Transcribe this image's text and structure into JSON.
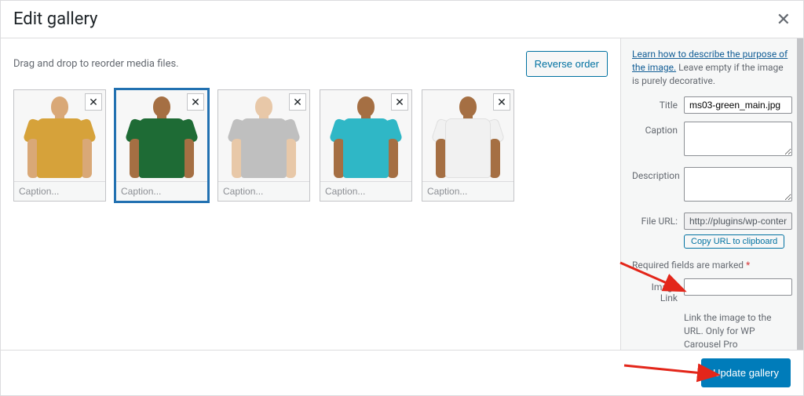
{
  "header": {
    "title": "Edit gallery"
  },
  "gallery": {
    "instructions": "Drag and drop to reorder media files.",
    "reverse_label": "Reverse order",
    "caption_placeholder": "Caption...",
    "items": [
      {
        "shirt_color": "c-yellow",
        "skin": "skin",
        "selected": false
      },
      {
        "shirt_color": "c-green",
        "skin": "skin2",
        "selected": true
      },
      {
        "shirt_color": "c-grey",
        "skin": "skin3",
        "selected": false
      },
      {
        "shirt_color": "c-teal",
        "skin": "skin2",
        "selected": false
      },
      {
        "shirt_color": "c-white",
        "skin": "skin2",
        "selected": false
      }
    ]
  },
  "sidebar": {
    "help_link": "Learn how to describe the purpose of the image.",
    "help_tail": " Leave empty if the image is purely decorative.",
    "title_label": "Title",
    "title_value": "ms03-green_main.jpg",
    "caption_label": "Caption",
    "description_label": "Description",
    "fileurl_label": "File URL:",
    "fileurl_value": "http://plugins/wp-conten",
    "copy_label": "Copy URL to clipboard",
    "required_text": "Required fields are marked ",
    "required_mark": "*",
    "imagelink_label": "Image Link",
    "imagelink_hint": "Link the image to the URL. Only for WP Carousel Pro"
  },
  "footer": {
    "update_label": "Update gallery"
  }
}
